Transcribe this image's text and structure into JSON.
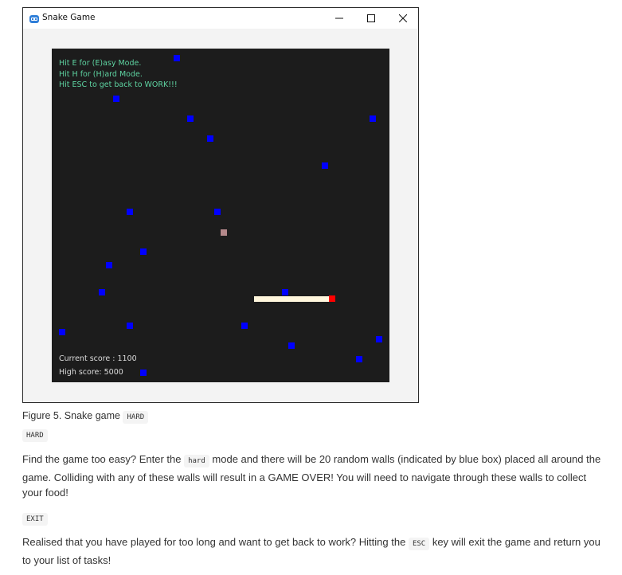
{
  "window": {
    "title": "Snake Game",
    "icon": "snake-app-icon",
    "controls": [
      "minimize-icon",
      "maximize-icon",
      "close-icon"
    ]
  },
  "game": {
    "help_lines": [
      "Hit E for (E)asy Mode.",
      "Hit H for (H)ard Mode.",
      "Hit ESC to get back to WORK!!!"
    ],
    "current_score": "Current score : 1100",
    "high_score": "High score: 5000",
    "colors": {
      "background": "#1c1c1c",
      "help_text": "#5ed3a1",
      "wall": "#0000ff",
      "food": "#b5898b",
      "snake_body": "#fff6dc",
      "snake_head": "#ff0000"
    }
  },
  "doc": {
    "caption_prefix": "Figure 5. Snake game",
    "caption_code": "HARD",
    "hard_label": "HARD",
    "hard_para_1": "Find the game too easy? Enter the",
    "hard_code": "hard",
    "hard_para_2": "mode and there will be 20 random walls (indicated by blue box) placed all around the game. Colliding with any of these walls will result in a GAME OVER! You will need to navigate through these walls to collect your food!",
    "exit_label": "EXIT",
    "exit_para_1": "Realised that you have played for too long and want to get back to work? Hitting the",
    "exit_code": "ESC",
    "exit_para_2": "key will exit the game and return you to your list of tasks!"
  }
}
